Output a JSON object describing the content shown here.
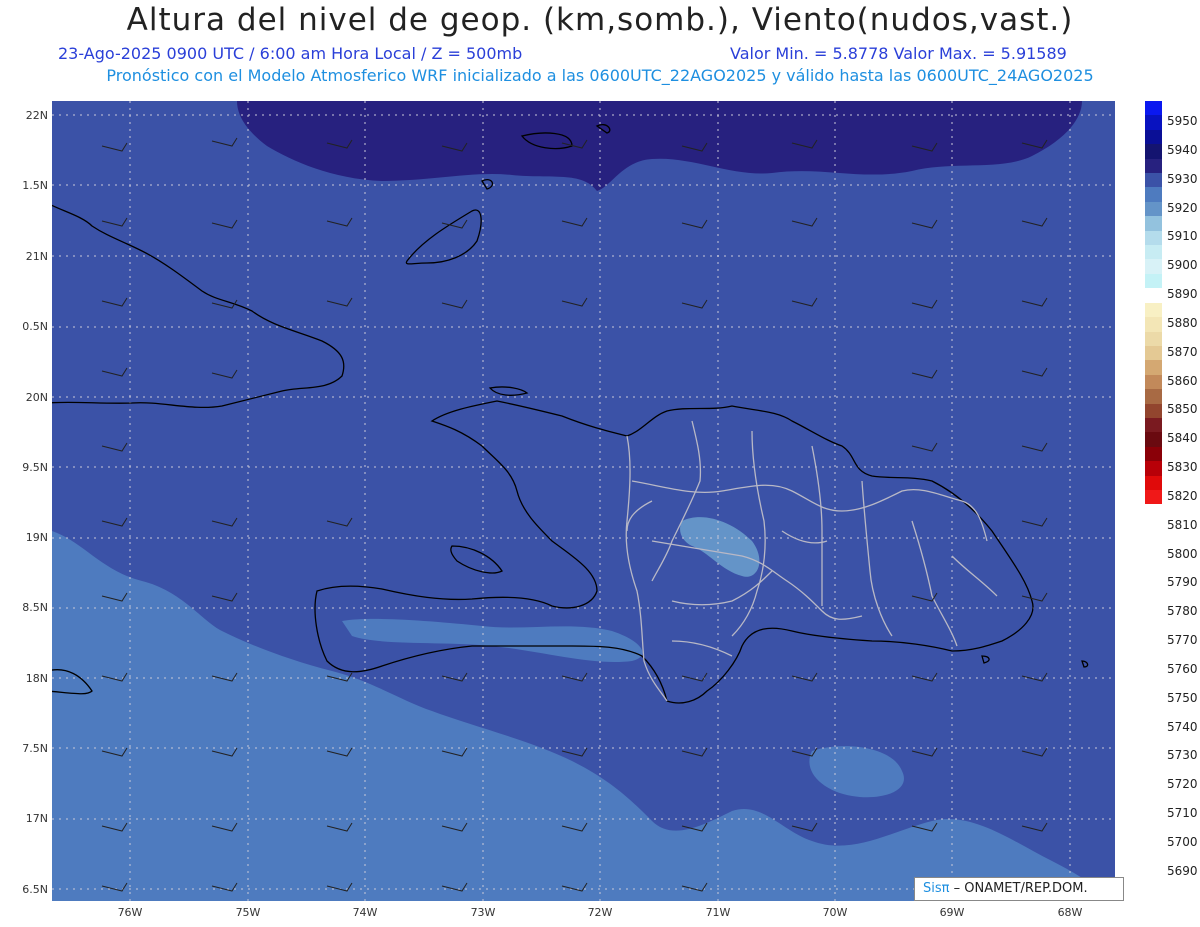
{
  "header": {
    "title": "Altura del nivel de geop. (km,somb.), Viento(nudos,vast.)",
    "line1_left": "23-Ago-2025  0900 UTC / 6:00 am Hora Local / Z = 500mb",
    "line1_right": "Valor Min. = 5.8778  Valor Max. = 5.91589",
    "line2": "Pronóstico con el Modelo Atmosferico WRF inicializado a las 0600UTC_22AGO2025 y válido hasta las  0600UTC_24AGO2025"
  },
  "axes": {
    "lat_labels": [
      "22N",
      "1.5N",
      "21N",
      "0.5N",
      "20N",
      "9.5N",
      "19N",
      "8.5N",
      "18N",
      "7.5N",
      "17N",
      "6.5N"
    ],
    "lon_labels": [
      "76W",
      "75W",
      "74W",
      "73W",
      "72W",
      "71W",
      "70W",
      "69W",
      "68W"
    ]
  },
  "colorbar": {
    "labels": [
      "5950",
      "5940",
      "5930",
      "5920",
      "5910",
      "5900",
      "5890",
      "5880",
      "5870",
      "5860",
      "5850",
      "5840",
      "5830",
      "5820",
      "5810",
      "5800",
      "5790",
      "5780",
      "5770",
      "5760",
      "5750",
      "5740",
      "5730",
      "5720",
      "5710",
      "5700",
      "5690"
    ],
    "colors": [
      "#0a18f0",
      "#0812c0",
      "#0a0f96",
      "#141470",
      "#27217f",
      "#3b52a7",
      "#4e7bbf",
      "#6494c8",
      "#93c2de",
      "#b4dcec",
      "#c7ecf3",
      "#d8f2f7",
      "#c4f2f6",
      "#ffffff",
      "#f8f0c4",
      "#f3e6b6",
      "#ecdaa8",
      "#e4c994",
      "#d4a872",
      "#c2895a",
      "#a86a44",
      "#92452e",
      "#7a1a20",
      "#6a0a10",
      "#8a0008",
      "#b80008",
      "#e00a0a",
      "#f01818"
    ]
  },
  "colors": {
    "field_5900": "#3b52a7",
    "field_5910": "#27217f",
    "field_5890": "#4e7bbf",
    "field_5880": "#6494c8"
  },
  "credit": {
    "logo": "Sisπ",
    "text": "– ONAMET/REP.DOM."
  }
}
